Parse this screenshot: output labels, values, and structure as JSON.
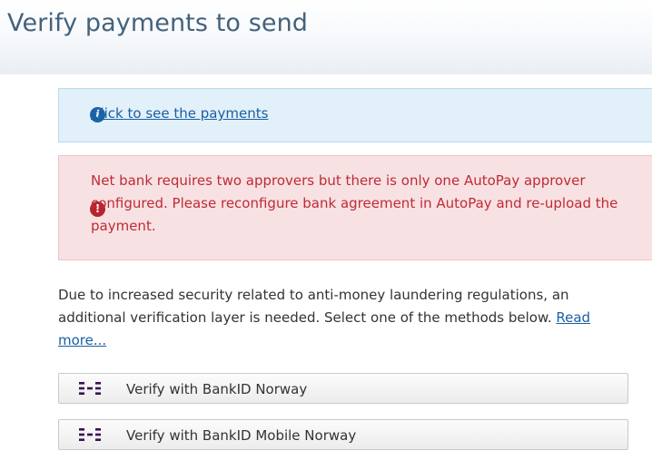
{
  "header": {
    "title": "Verify payments to send"
  },
  "info_alert": {
    "icon": "info-icon",
    "link_text": "Click to see the payments",
    "color": "#1a66a8"
  },
  "error_alert": {
    "icon": "error-icon",
    "message": "Net bank requires two approvers but there is only one AutoPay approver configured. Please reconfigure bank agreement in AutoPay and re-upload the payment.",
    "color": "#bf2b35"
  },
  "description": {
    "text": "Due to increased security related to anti-money laundering regulations, an additional verification layer is needed. Select one of the methods below. ",
    "read_more": "Read more..."
  },
  "verify_buttons": [
    {
      "label": "Verify with BankID Norway",
      "icon": "bankid-icon"
    },
    {
      "label": "Verify with BankID Mobile Norway",
      "icon": "bankid-icon"
    }
  ],
  "colors": {
    "bankid_purple": "#3b1054",
    "title": "#44627b"
  }
}
